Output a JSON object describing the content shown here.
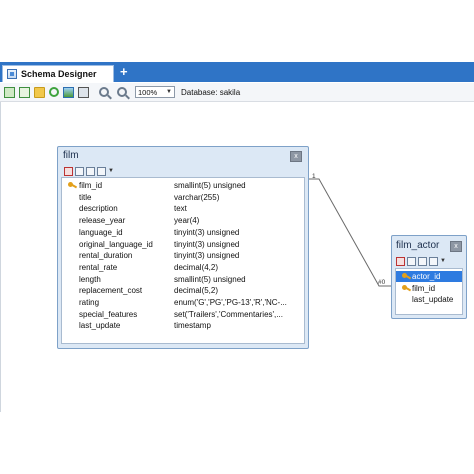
{
  "tab": {
    "label": "Schema Designer",
    "add_label": "+"
  },
  "toolbar": {
    "zoom_value": "100%",
    "database_label": "Database: sakila"
  },
  "tables": {
    "film": {
      "title": "film",
      "close": "x",
      "columns": [
        {
          "name": "film_id",
          "type": "smallint(5) unsigned",
          "key": true
        },
        {
          "name": "title",
          "type": "varchar(255)",
          "key": false
        },
        {
          "name": "description",
          "type": "text",
          "key": false
        },
        {
          "name": "release_year",
          "type": "year(4)",
          "key": false
        },
        {
          "name": "language_id",
          "type": "tinyint(3) unsigned",
          "key": false
        },
        {
          "name": "original_language_id",
          "type": "tinyint(3) unsigned",
          "key": false
        },
        {
          "name": "rental_duration",
          "type": "tinyint(3) unsigned",
          "key": false
        },
        {
          "name": "rental_rate",
          "type": "decimal(4,2)",
          "key": false
        },
        {
          "name": "length",
          "type": "smallint(5) unsigned",
          "key": false
        },
        {
          "name": "replacement_cost",
          "type": "decimal(5,2)",
          "key": false
        },
        {
          "name": "rating",
          "type": "enum('G','PG','PG-13','R','NC-...",
          "key": false
        },
        {
          "name": "special_features",
          "type": "set('Trailers','Commentaries',...",
          "key": false
        },
        {
          "name": "last_update",
          "type": "timestamp",
          "key": false
        }
      ]
    },
    "film_actor": {
      "title": "film_actor",
      "close": "x",
      "columns": [
        {
          "name": "actor_id",
          "key": true,
          "selected": true
        },
        {
          "name": "film_id",
          "key": true,
          "selected": false
        },
        {
          "name": "last_update",
          "key": false,
          "selected": false
        }
      ]
    }
  },
  "relation": {
    "start_label": "1",
    "end_label": "#0"
  },
  "colors": {
    "tab_bar": "#2f74c6",
    "table_bg": "#dce8f5",
    "selected_row": "#2e7be0"
  }
}
